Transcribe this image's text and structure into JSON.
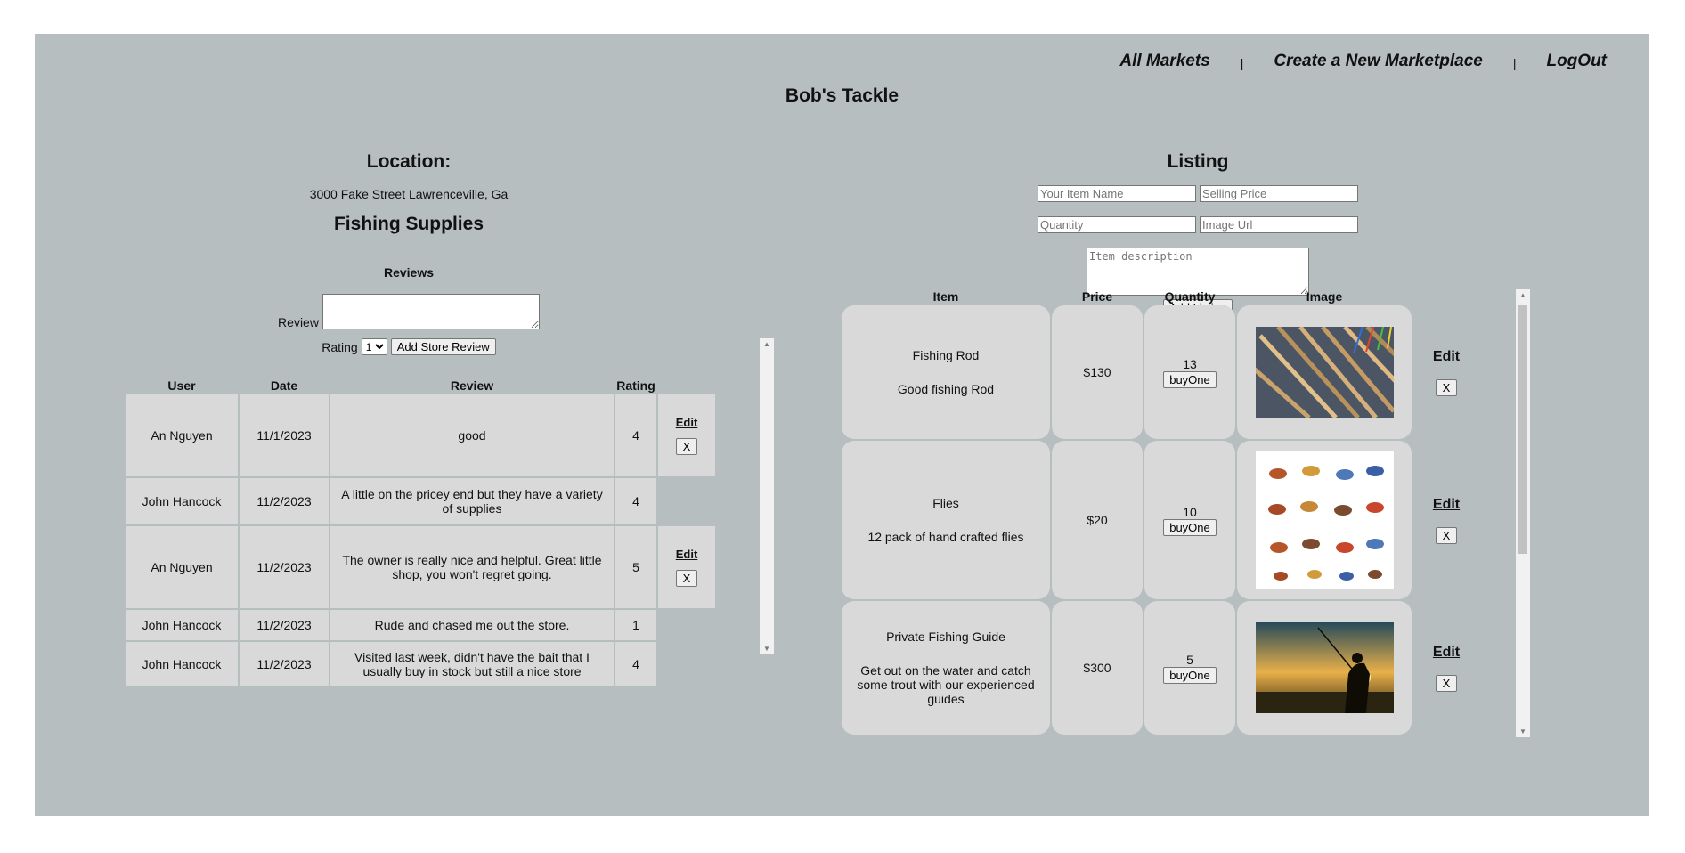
{
  "nav": {
    "all_markets": "All Markets",
    "create": "Create a New Marketplace",
    "logout": "LogOut",
    "sep": "|"
  },
  "store": {
    "title": "Bob's Tackle"
  },
  "location": {
    "heading": "Location:",
    "address": "3000 Fake Street Lawrenceville, Ga",
    "category": "Fishing Supplies"
  },
  "reviews": {
    "heading": "Reviews",
    "review_label": "Review",
    "rating_label": "Rating",
    "rating_selected": "1",
    "add_button": "Add Store Review",
    "columns": [
      "User",
      "Date",
      "Review",
      "Rating"
    ],
    "edit_label": "Edit",
    "delete_label": "X",
    "rows": [
      {
        "user": "An Nguyen",
        "date": "11/1/2023",
        "review": "good",
        "rating": "4"
      },
      {
        "user": "John Hancock",
        "date": "11/2/2023",
        "review": "A little on the pricey end but they have a variety of supplies",
        "rating": "4"
      },
      {
        "user": "An Nguyen",
        "date": "11/2/2023",
        "review": "The owner is really nice and helpful. Great little shop, you won't regret going.",
        "rating": "5"
      },
      {
        "user": "John Hancock",
        "date": "11/2/2023",
        "review": "Rude and chased me out the store.",
        "rating": "1"
      },
      {
        "user": "John Hancock",
        "date": "11/2/2023",
        "review": "Visited last week, didn't have the bait that I usually buy in stock but still a nice store",
        "rating": "4"
      }
    ]
  },
  "listing": {
    "heading": "Listing",
    "item_name_placeholder": "Your Item Name",
    "price_placeholder": "Selling Price",
    "quantity_placeholder": "Quantity",
    "image_placeholder": "Image Url",
    "desc_placeholder": "Item description",
    "add_button": "Add Listing",
    "columns": [
      "Item",
      "Price",
      "Quantity",
      "Image"
    ],
    "buy_label": "buyOne",
    "edit_label": "Edit",
    "delete_label": "X",
    "items": [
      {
        "name": "Fishing Rod",
        "desc": "Good fishing Rod",
        "price": "$130",
        "quantity": "13"
      },
      {
        "name": "Flies",
        "desc": "12 pack of hand crafted flies",
        "price": "$20",
        "quantity": "10"
      },
      {
        "name": "Private Fishing Guide",
        "desc": "Get out on the water and catch some trout with our experienced guides",
        "price": "$300",
        "quantity": "5"
      }
    ]
  },
  "colors": {
    "background": "#b6bec0",
    "cell": "#d9d9d9"
  }
}
